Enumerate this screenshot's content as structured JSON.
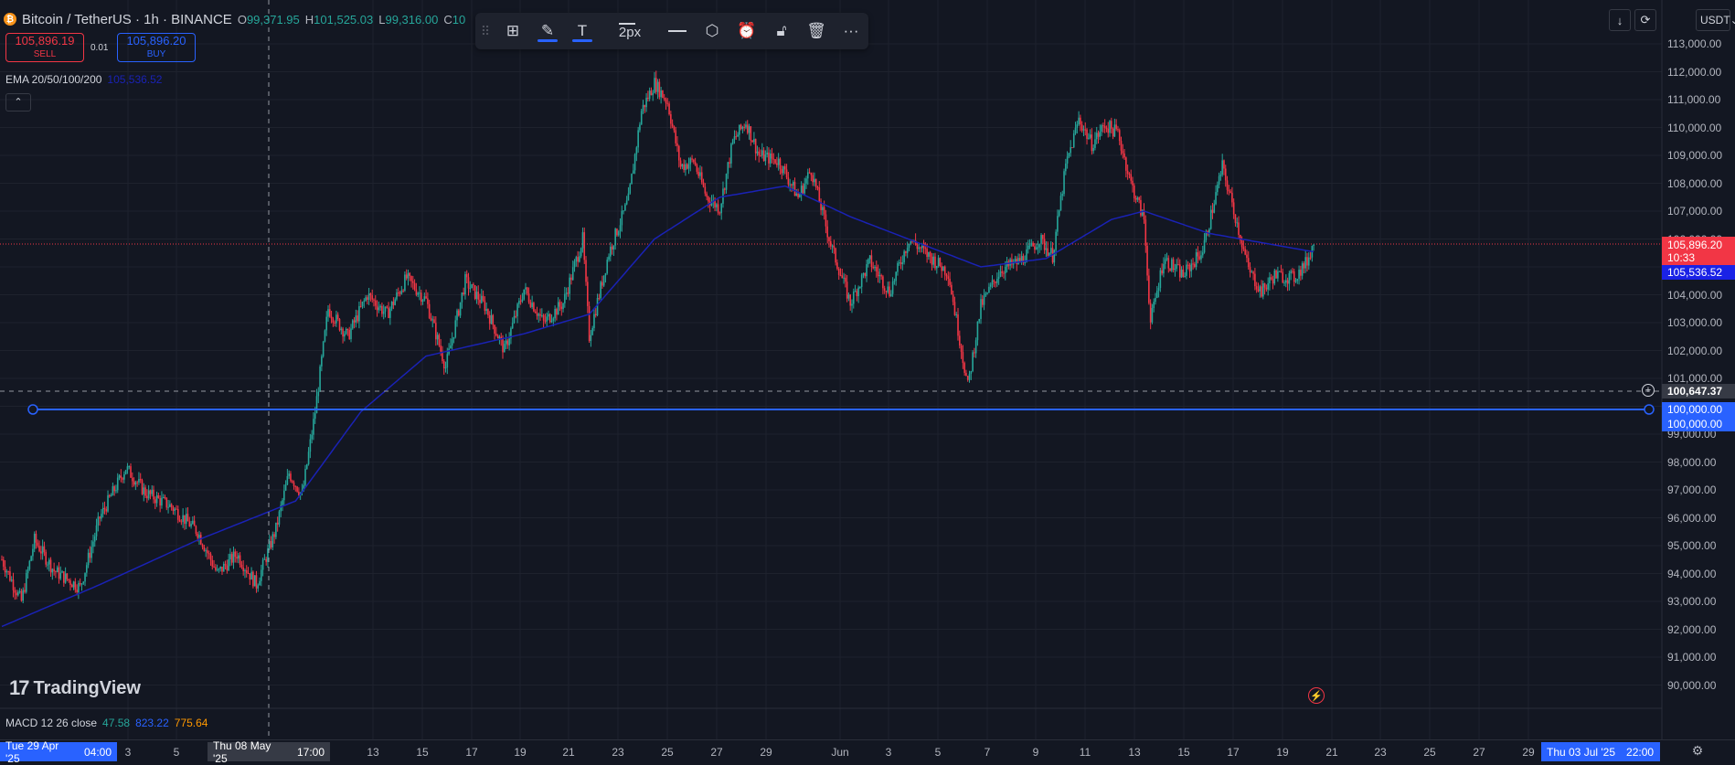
{
  "header": {
    "symbol": "Bitcoin / TetherUS · 1h · BINANCE",
    "ohlc": [
      {
        "k": "O",
        "v": "99,371.95"
      },
      {
        "k": "H",
        "v": "101,525.03"
      },
      {
        "k": "L",
        "v": "99,316.00"
      },
      {
        "k": "C",
        "v": "10"
      }
    ]
  },
  "trade": {
    "sell_price": "105,896.19",
    "sell_label": "SELL",
    "buy_price": "105,896.20",
    "buy_label": "BUY",
    "quantity": "0.01"
  },
  "indicators": {
    "ema_label": "EMA 20/50/100/200",
    "ema_value": "105,536.52",
    "macd_label": "MACD 12 26 close",
    "macd_macd": "47.58",
    "macd_signal": "823.22",
    "macd_hist": "775.64"
  },
  "toolbar": {
    "width_label": "2px",
    "icons": [
      "drag-handle-icon",
      "templates-icon",
      "pencil-icon",
      "text-icon",
      "line-width-icon",
      "line-style-icon",
      "settings-icon",
      "alert-icon",
      "lock-icon",
      "trash-icon",
      "more-icon"
    ]
  },
  "top_right": {
    "currency": "USDT"
  },
  "price_axis": {
    "ticks": [
      "113,000.00",
      "112,000.00",
      "111,000.00",
      "110,000.00",
      "109,000.00",
      "108,000.00",
      "107,000.00",
      "106,000.00",
      "105,000.00",
      "104,000.00",
      "103,000.00",
      "102,000.00",
      "101,000.00",
      "100,000.00",
      "99,000.00",
      "98,000.00",
      "97,000.00",
      "96,000.00",
      "95,000.00",
      "94,000.00",
      "93,000.00",
      "92,000.00",
      "91,000.00",
      "90,000.00"
    ],
    "last_price": "105,896.20",
    "countdown": "10:33",
    "ema_price": "105,536.52",
    "crosshair_price": "100,647.37",
    "hline_price_1": "100,000.00",
    "hline_price_2": "100,000.00"
  },
  "time_axis": {
    "ticks": [
      "3",
      "5",
      "13",
      "15",
      "17",
      "19",
      "21",
      "23",
      "25",
      "27",
      "29",
      "Jun",
      "3",
      "5",
      "7",
      "9",
      "11",
      "13",
      "15",
      "17",
      "19",
      "21",
      "23",
      "25",
      "27",
      "29"
    ],
    "start_label": "Tue 29 Apr '25",
    "start_time": "04:00",
    "crosshair_label": "Thu 08 May '25",
    "crosshair_time": "17:00",
    "end_label": "Thu 03 Jul '25",
    "end_time": "22:00"
  },
  "watermark": "TradingView",
  "colors": {
    "background": "#131722",
    "up": "#26a69a",
    "down": "#f23645",
    "ema": "#1a22b5",
    "hline": "#2962ff"
  },
  "chart_data": {
    "type": "candlestick",
    "ylim": [
      89500,
      113600
    ],
    "price_key_points": [
      [
        0,
        94500
      ],
      [
        3,
        93000
      ],
      [
        5,
        95200
      ],
      [
        8,
        94100
      ],
      [
        12,
        93500
      ],
      [
        15,
        96000
      ],
      [
        19,
        97800
      ],
      [
        22,
        96900
      ],
      [
        26,
        96400
      ],
      [
        30,
        95500
      ],
      [
        33,
        94000
      ],
      [
        36,
        94700
      ],
      [
        39,
        93600
      ],
      [
        42,
        95600
      ],
      [
        44,
        97600
      ],
      [
        46,
        96800
      ],
      [
        48,
        99800
      ],
      [
        50,
        103500
      ],
      [
        53,
        102500
      ],
      [
        56,
        104000
      ],
      [
        59,
        103300
      ],
      [
        62,
        104600
      ],
      [
        65,
        103800
      ],
      [
        68,
        101400
      ],
      [
        71,
        104500
      ],
      [
        74,
        103600
      ],
      [
        77,
        102000
      ],
      [
        80,
        104200
      ],
      [
        83,
        103000
      ],
      [
        86,
        103700
      ],
      [
        89,
        106000
      ],
      [
        90,
        102500
      ],
      [
        93,
        105500
      ],
      [
        96,
        107400
      ],
      [
        98,
        110600
      ],
      [
        100,
        111600
      ],
      [
        102,
        110900
      ],
      [
        104,
        108600
      ],
      [
        106,
        108800
      ],
      [
        108,
        107500
      ],
      [
        110,
        107100
      ],
      [
        112,
        109500
      ],
      [
        114,
        110200
      ],
      [
        116,
        109000
      ],
      [
        119,
        108800
      ],
      [
        122,
        107500
      ],
      [
        124,
        108500
      ],
      [
        127,
        105800
      ],
      [
        130,
        103700
      ],
      [
        133,
        105200
      ],
      [
        136,
        104100
      ],
      [
        139,
        106000
      ],
      [
        142,
        105400
      ],
      [
        145,
        104800
      ],
      [
        148,
        100700
      ],
      [
        150,
        103600
      ],
      [
        153,
        104900
      ],
      [
        156,
        105200
      ],
      [
        159,
        106000
      ],
      [
        161,
        105400
      ],
      [
        163,
        108600
      ],
      [
        165,
        110300
      ],
      [
        167,
        109400
      ],
      [
        169,
        110100
      ],
      [
        171,
        109800
      ],
      [
        173,
        108000
      ],
      [
        175,
        106700
      ],
      [
        176,
        103000
      ],
      [
        178,
        105300
      ],
      [
        181,
        104700
      ],
      [
        184,
        105600
      ],
      [
        187,
        108600
      ],
      [
        189,
        106800
      ],
      [
        191,
        104900
      ],
      [
        193,
        104100
      ],
      [
        195,
        104700
      ],
      [
        198,
        104600
      ],
      [
        200,
        105200
      ],
      [
        201,
        105900
      ]
    ],
    "ema_key_points": [
      [
        0,
        92100
      ],
      [
        15,
        93600
      ],
      [
        30,
        95200
      ],
      [
        45,
        96600
      ],
      [
        55,
        99800
      ],
      [
        65,
        101800
      ],
      [
        80,
        102600
      ],
      [
        90,
        103300
      ],
      [
        100,
        106000
      ],
      [
        110,
        107500
      ],
      [
        120,
        107900
      ],
      [
        130,
        106800
      ],
      [
        140,
        105900
      ],
      [
        150,
        105000
      ],
      [
        160,
        105300
      ],
      [
        170,
        106700
      ],
      [
        175,
        107000
      ],
      [
        185,
        106200
      ],
      [
        201,
        105540
      ]
    ]
  }
}
